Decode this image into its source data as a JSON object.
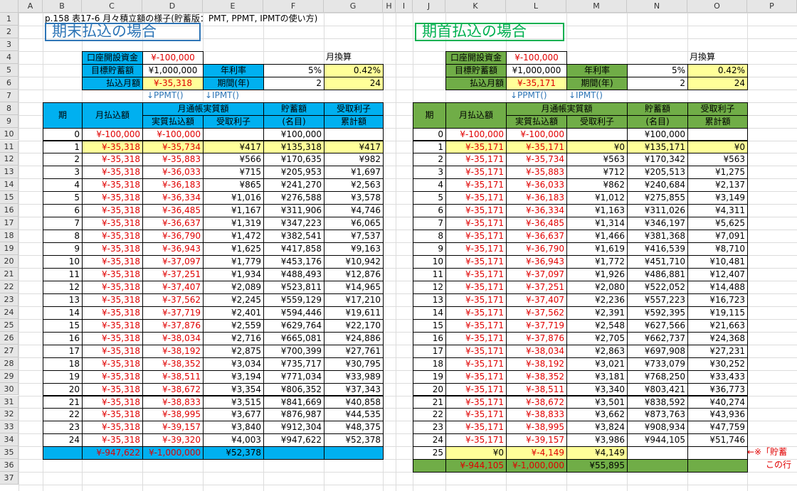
{
  "columns": [
    "A",
    "B",
    "C",
    "D",
    "E",
    "F",
    "G",
    "H",
    "I",
    "J",
    "K",
    "L",
    "M",
    "N",
    "O",
    "P"
  ],
  "rows": [
    1,
    2,
    3,
    4,
    5,
    6,
    7,
    8,
    9,
    10,
    11,
    12,
    13,
    14,
    15,
    16,
    17,
    18,
    19,
    20,
    21,
    22,
    23,
    24,
    25,
    26,
    27,
    28,
    29,
    30,
    31,
    32,
    33,
    34,
    35,
    36,
    37
  ],
  "colors": {
    "blue": "#00b0f0",
    "green": "#70ad47",
    "yellow": "#ffff99",
    "red": "#e00000",
    "titleBlue": "#2e75b6",
    "titleGreen": "#00b050"
  },
  "sheet_title": "p.158 表17-6 月々積立額の様子(貯蓄版：PMT, PPMT, IPMTの使い方)",
  "left": {
    "heading": "期末払込の場合",
    "params": {
      "open_label": "口座開設資金",
      "open_value": "¥-100,000",
      "target_label": "目標貯蓄額",
      "target_value": "¥1,000,000",
      "pay_label": "払込月額",
      "pay_value": "¥-35,318",
      "rate_label": "年利率",
      "rate_value": "5%",
      "period_label": "期間(年)",
      "period_value": "2",
      "monthly_label": "月換算",
      "monthly_rate": "0.42%",
      "months": "24"
    },
    "ppmt_note": "↓PPMT()",
    "ipmt_note": "↓IPMT()",
    "headers": {
      "period": "期",
      "payment": "月払込額",
      "passbook": "月通帳実質額",
      "principal": "実質払込額",
      "interest": "受取利子",
      "savings": "貯蓄額",
      "savings_sub": "(名目)",
      "cum_interest": "受取利子",
      "cum_sub": "累計額"
    },
    "rows": [
      [
        "0",
        "¥-100,000",
        "¥-100,000",
        "",
        "¥100,000",
        ""
      ],
      [
        "1",
        "¥-35,318",
        "¥-35,734",
        "¥417",
        "¥135,318",
        "¥417"
      ],
      [
        "2",
        "¥-35,318",
        "¥-35,883",
        "¥566",
        "¥170,635",
        "¥982"
      ],
      [
        "3",
        "¥-35,318",
        "¥-36,033",
        "¥715",
        "¥205,953",
        "¥1,697"
      ],
      [
        "4",
        "¥-35,318",
        "¥-36,183",
        "¥865",
        "¥241,270",
        "¥2,563"
      ],
      [
        "5",
        "¥-35,318",
        "¥-36,334",
        "¥1,016",
        "¥276,588",
        "¥3,578"
      ],
      [
        "6",
        "¥-35,318",
        "¥-36,485",
        "¥1,167",
        "¥311,906",
        "¥4,746"
      ],
      [
        "7",
        "¥-35,318",
        "¥-36,637",
        "¥1,319",
        "¥347,223",
        "¥6,065"
      ],
      [
        "8",
        "¥-35,318",
        "¥-36,790",
        "¥1,472",
        "¥382,541",
        "¥7,537"
      ],
      [
        "9",
        "¥-35,318",
        "¥-36,943",
        "¥1,625",
        "¥417,858",
        "¥9,163"
      ],
      [
        "10",
        "¥-35,318",
        "¥-37,097",
        "¥1,779",
        "¥453,176",
        "¥10,942"
      ],
      [
        "11",
        "¥-35,318",
        "¥-37,251",
        "¥1,934",
        "¥488,493",
        "¥12,876"
      ],
      [
        "12",
        "¥-35,318",
        "¥-37,407",
        "¥2,089",
        "¥523,811",
        "¥14,965"
      ],
      [
        "13",
        "¥-35,318",
        "¥-37,562",
        "¥2,245",
        "¥559,129",
        "¥17,210"
      ],
      [
        "14",
        "¥-35,318",
        "¥-37,719",
        "¥2,401",
        "¥594,446",
        "¥19,611"
      ],
      [
        "15",
        "¥-35,318",
        "¥-37,876",
        "¥2,559",
        "¥629,764",
        "¥22,170"
      ],
      [
        "16",
        "¥-35,318",
        "¥-38,034",
        "¥2,716",
        "¥665,081",
        "¥24,886"
      ],
      [
        "17",
        "¥-35,318",
        "¥-38,192",
        "¥2,875",
        "¥700,399",
        "¥27,761"
      ],
      [
        "18",
        "¥-35,318",
        "¥-38,352",
        "¥3,034",
        "¥735,717",
        "¥30,795"
      ],
      [
        "19",
        "¥-35,318",
        "¥-38,511",
        "¥3,194",
        "¥771,034",
        "¥33,989"
      ],
      [
        "20",
        "¥-35,318",
        "¥-38,672",
        "¥3,354",
        "¥806,352",
        "¥37,343"
      ],
      [
        "21",
        "¥-35,318",
        "¥-38,833",
        "¥3,515",
        "¥841,669",
        "¥40,858"
      ],
      [
        "22",
        "¥-35,318",
        "¥-38,995",
        "¥3,677",
        "¥876,987",
        "¥44,535"
      ],
      [
        "23",
        "¥-35,318",
        "¥-39,157",
        "¥3,840",
        "¥912,304",
        "¥48,375"
      ],
      [
        "24",
        "¥-35,318",
        "¥-39,320",
        "¥4,003",
        "¥947,622",
        "¥52,378"
      ]
    ],
    "totals": [
      "",
      "¥-947,622",
      "¥-1,000,000",
      "¥52,378",
      "",
      ""
    ]
  },
  "right": {
    "heading": "期首払込の場合",
    "params": {
      "open_label": "口座開設資金",
      "open_value": "¥-100,000",
      "target_label": "目標貯蓄額",
      "target_value": "¥1,000,000",
      "pay_label": "払込月額",
      "pay_value": "¥-35,171",
      "rate_label": "年利率",
      "rate_value": "5%",
      "period_label": "期間(年)",
      "period_value": "2",
      "monthly_label": "月換算",
      "monthly_rate": "0.42%",
      "months": "24"
    },
    "ppmt_note": "↓PPMT()",
    "ipmt_note": "↓IPMT()",
    "headers": {
      "period": "期",
      "payment": "月払込額",
      "passbook": "月通帳実質額",
      "principal": "実質払込額",
      "interest": "受取利子",
      "savings": "貯蓄額",
      "savings_sub": "(名目)",
      "cum_interest": "受取利子",
      "cum_sub": "累計額"
    },
    "rows": [
      [
        "0",
        "¥-100,000",
        "¥-100,000",
        "",
        "¥100,000",
        ""
      ],
      [
        "1",
        "¥-35,171",
        "¥-35,171",
        "¥0",
        "¥135,171",
        "¥0"
      ],
      [
        "2",
        "¥-35,171",
        "¥-35,734",
        "¥563",
        "¥170,342",
        "¥563"
      ],
      [
        "3",
        "¥-35,171",
        "¥-35,883",
        "¥712",
        "¥205,513",
        "¥1,275"
      ],
      [
        "4",
        "¥-35,171",
        "¥-36,033",
        "¥862",
        "¥240,684",
        "¥2,137"
      ],
      [
        "5",
        "¥-35,171",
        "¥-36,183",
        "¥1,012",
        "¥275,855",
        "¥3,149"
      ],
      [
        "6",
        "¥-35,171",
        "¥-36,334",
        "¥1,163",
        "¥311,026",
        "¥4,311"
      ],
      [
        "7",
        "¥-35,171",
        "¥-36,485",
        "¥1,314",
        "¥346,197",
        "¥5,625"
      ],
      [
        "8",
        "¥-35,171",
        "¥-36,637",
        "¥1,466",
        "¥381,368",
        "¥7,091"
      ],
      [
        "9",
        "¥-35,171",
        "¥-36,790",
        "¥1,619",
        "¥416,539",
        "¥8,710"
      ],
      [
        "10",
        "¥-35,171",
        "¥-36,943",
        "¥1,772",
        "¥451,710",
        "¥10,481"
      ],
      [
        "11",
        "¥-35,171",
        "¥-37,097",
        "¥1,926",
        "¥486,881",
        "¥12,407"
      ],
      [
        "12",
        "¥-35,171",
        "¥-37,251",
        "¥2,080",
        "¥522,052",
        "¥14,488"
      ],
      [
        "13",
        "¥-35,171",
        "¥-37,407",
        "¥2,236",
        "¥557,223",
        "¥16,723"
      ],
      [
        "14",
        "¥-35,171",
        "¥-37,562",
        "¥2,391",
        "¥592,395",
        "¥19,115"
      ],
      [
        "15",
        "¥-35,171",
        "¥-37,719",
        "¥2,548",
        "¥627,566",
        "¥21,663"
      ],
      [
        "16",
        "¥-35,171",
        "¥-37,876",
        "¥2,705",
        "¥662,737",
        "¥24,368"
      ],
      [
        "17",
        "¥-35,171",
        "¥-38,034",
        "¥2,863",
        "¥697,908",
        "¥27,231"
      ],
      [
        "18",
        "¥-35,171",
        "¥-38,192",
        "¥3,021",
        "¥733,079",
        "¥30,252"
      ],
      [
        "19",
        "¥-35,171",
        "¥-38,352",
        "¥3,181",
        "¥768,250",
        "¥33,433"
      ],
      [
        "20",
        "¥-35,171",
        "¥-38,511",
        "¥3,340",
        "¥803,421",
        "¥36,773"
      ],
      [
        "21",
        "¥-35,171",
        "¥-38,672",
        "¥3,501",
        "¥838,592",
        "¥40,274"
      ],
      [
        "22",
        "¥-35,171",
        "¥-38,833",
        "¥3,662",
        "¥873,763",
        "¥43,936"
      ],
      [
        "23",
        "¥-35,171",
        "¥-38,995",
        "¥3,824",
        "¥908,934",
        "¥47,759"
      ],
      [
        "24",
        "¥-35,171",
        "¥-39,157",
        "¥3,986",
        "¥944,105",
        "¥51,746"
      ],
      [
        "25",
        "¥0",
        "¥-4,149",
        "¥4,149",
        "",
        ""
      ]
    ],
    "totals": [
      "",
      "¥-944,105",
      "¥-1,000,000",
      "¥55,895",
      "",
      ""
    ],
    "note_line1": "←※「貯蓄",
    "note_line2": "この行"
  }
}
